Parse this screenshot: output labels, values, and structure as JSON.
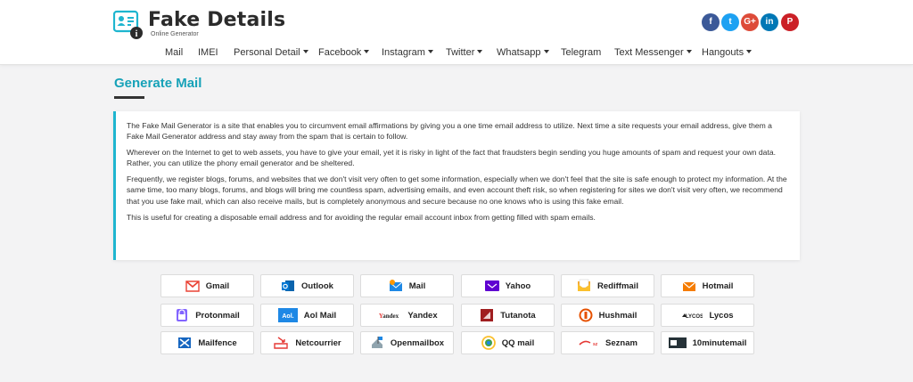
{
  "site": {
    "title": "Fake Details",
    "subtitle": "Online Generator"
  },
  "social": [
    {
      "name": "facebook-icon",
      "glyph": "f",
      "color": "#3b5998"
    },
    {
      "name": "twitter-icon",
      "glyph": "t",
      "color": "#1da1f2"
    },
    {
      "name": "google-plus-icon",
      "glyph": "G+",
      "color": "#dd4b39"
    },
    {
      "name": "linkedin-icon",
      "glyph": "in",
      "color": "#0077b5"
    },
    {
      "name": "pinterest-icon",
      "glyph": "P",
      "color": "#cb2027"
    }
  ],
  "nav": [
    {
      "label": "Mail",
      "dropdown": false
    },
    {
      "label": "IMEI",
      "dropdown": false
    },
    {
      "label": "Personal Detail",
      "dropdown": true
    },
    {
      "label": "Facebook",
      "dropdown": true
    },
    {
      "label": "Instagram",
      "dropdown": true
    },
    {
      "label": "Twitter",
      "dropdown": true
    },
    {
      "label": "Whatsapp",
      "dropdown": true
    },
    {
      "label": "Telegram",
      "dropdown": false
    },
    {
      "label": "Text Messenger",
      "dropdown": true
    },
    {
      "label": "Hangouts",
      "dropdown": true
    }
  ],
  "page": {
    "title": "Generate Mail"
  },
  "description": [
    "The Fake Mail Generator is a site that enables you to circumvent email affirmations by giving you a one time email address to utilize. Next time a site requests your email address, give them a Fake Mail Generator address and stay away from the spam that is certain to follow.",
    "Wherever on the Internet to get to web assets, you have to give your email, yet it is risky in light of the fact that fraudsters begin sending you huge amounts of spam and request your own data. Rather, you can utilize the phony email generator and be sheltered.",
    "Frequently, we register blogs, forums, and websites that we don't visit very often to get some information, especially when we don't feel that the site is safe enough to protect my information. At the same time, too many blogs, forums, and blogs will bring me countless spam, advertising emails, and even account theft risk, so when registering for sites we don't visit very often, we recommend that you use fake mail, which can also receive mails, but is completely anonymous and secure because no one knows who is using this fake email.",
    "This is useful for creating a disposable email address and for avoiding the regular email account inbox from getting filled with spam emails."
  ],
  "providers": [
    {
      "label": "Gmail",
      "icon": "gmail-icon"
    },
    {
      "label": "Outlook",
      "icon": "outlook-icon"
    },
    {
      "label": "Mail",
      "icon": "mail-icon"
    },
    {
      "label": "Yahoo",
      "icon": "yahoo-icon"
    },
    {
      "label": "Rediffmail",
      "icon": "rediffmail-icon"
    },
    {
      "label": "Hotmail",
      "icon": "hotmail-icon"
    },
    {
      "label": "Protonmail",
      "icon": "protonmail-icon"
    },
    {
      "label": "Aol Mail",
      "icon": "aol-icon",
      "icon_text": "Aol."
    },
    {
      "label": "Yandex",
      "icon": "yandex-icon",
      "icon_text": "Yandex"
    },
    {
      "label": "Tutanota",
      "icon": "tutanota-icon"
    },
    {
      "label": "Hushmail",
      "icon": "hushmail-icon"
    },
    {
      "label": "Lycos",
      "icon": "lycos-icon",
      "icon_text": "LYCOS"
    },
    {
      "label": "Mailfence",
      "icon": "mailfence-icon"
    },
    {
      "label": "Netcourrier",
      "icon": "netcourrier-icon"
    },
    {
      "label": "Openmailbox",
      "icon": "openmailbox-icon"
    },
    {
      "label": "QQ mail",
      "icon": "qq-mail-icon"
    },
    {
      "label": "Seznam",
      "icon": "seznam-icon"
    },
    {
      "label": "10minutemail",
      "icon": "10minutemail-icon"
    }
  ]
}
